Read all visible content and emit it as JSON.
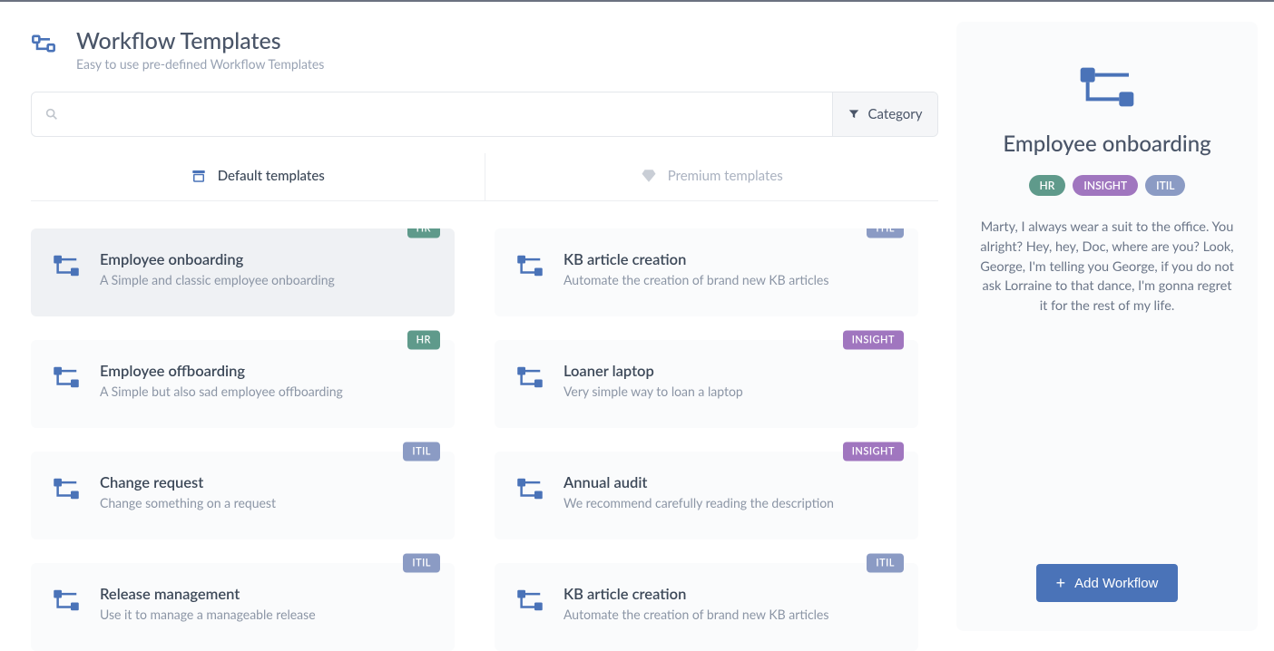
{
  "header": {
    "title": "Workflow Templates",
    "subtitle": "Easy to use pre-defined Workflow Templates"
  },
  "search": {
    "placeholder": "",
    "category_label": "Category"
  },
  "tabs": {
    "default": "Default templates",
    "premium": "Premium templates",
    "active": "default"
  },
  "tags": {
    "HR": "HR",
    "ITIL": "ITIL",
    "INSIGHT": "INSIGHT"
  },
  "cards": [
    {
      "title": "Employee onboarding",
      "desc": "A Simple and classic employee onboarding",
      "tag": "HR",
      "selected": true
    },
    {
      "title": "KB article creation",
      "desc": "Automate the creation of brand new KB articles",
      "tag": "ITIL",
      "selected": false
    },
    {
      "title": "Employee offboarding",
      "desc": "A Simple but also sad employee offboarding",
      "tag": "HR",
      "selected": false
    },
    {
      "title": "Loaner laptop",
      "desc": "Very simple way to loan a laptop",
      "tag": "INSIGHT",
      "selected": false
    },
    {
      "title": "Change request",
      "desc": "Change something on a request",
      "tag": "ITIL",
      "selected": false
    },
    {
      "title": "Annual audit",
      "desc": "We recommend carefully reading the description",
      "tag": "INSIGHT",
      "selected": false
    },
    {
      "title": "Release management",
      "desc": "Use it to manage a manageable release",
      "tag": "ITIL",
      "selected": false
    },
    {
      "title": "KB article creation",
      "desc": "Automate the creation of brand new KB articles",
      "tag": "ITIL",
      "selected": false
    }
  ],
  "detail": {
    "title": "Employee onboarding",
    "tags": [
      "HR",
      "INSIGHT",
      "ITIL"
    ],
    "description": "Marty, I always wear a suit to the office. You alright? Hey, hey, Doc, where are you? Look, George, I'm telling you George, if you do not ask Lorraine to that dance, I'm gonna regret it for the rest of my life.",
    "add_label": "Add Workflow"
  }
}
